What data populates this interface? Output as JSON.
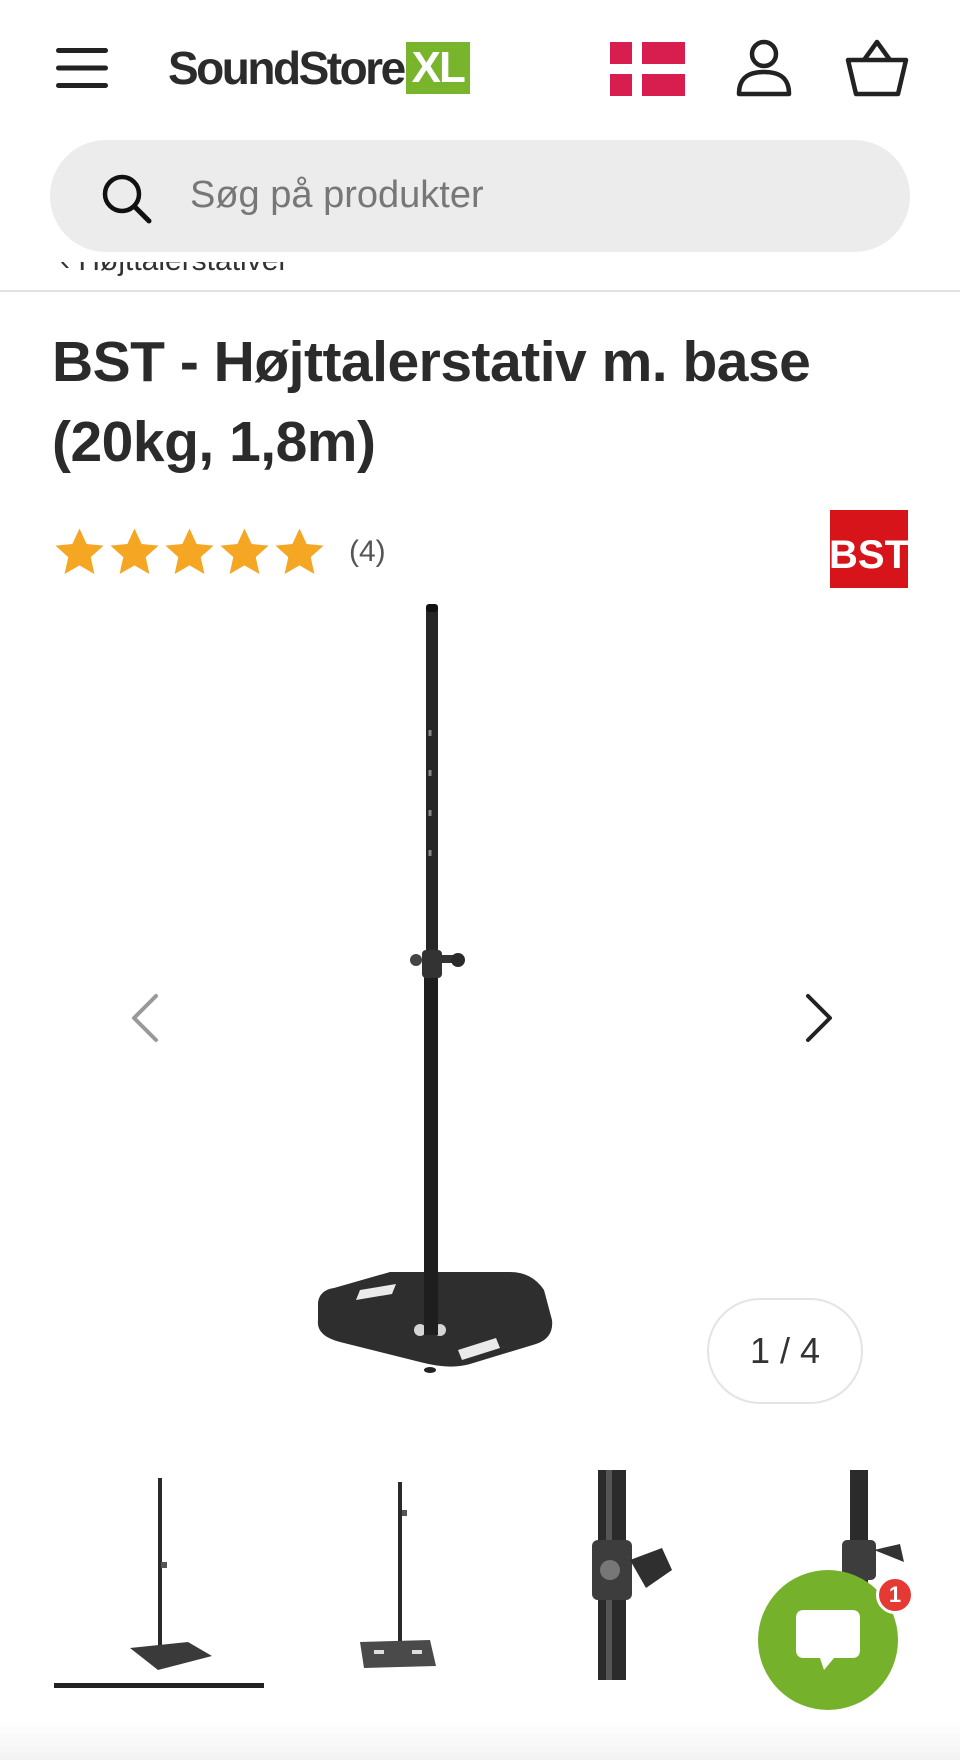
{
  "header": {
    "menu_icon": "hamburger-menu-icon",
    "logo": {
      "text": "SoundStore",
      "badge": "XL",
      "badge_color": "#78b52c"
    },
    "flag_icon": "denmark-flag-icon",
    "account_icon": "user-icon",
    "cart_icon": "basket-icon"
  },
  "search": {
    "placeholder": "Søg på produkter",
    "icon": "search-icon"
  },
  "breadcrumb": {
    "label": "Højttalerstativer"
  },
  "product": {
    "title": "BST - Højttalerstativ m. base (20kg, 1,8m)",
    "rating": {
      "stars": 5,
      "max": 5,
      "count_label": "(4)",
      "star_color": "#f5a623"
    },
    "brand": {
      "text": "BST",
      "color": "#d7141a"
    }
  },
  "gallery": {
    "pager_label": "1 / 4",
    "current": 1,
    "total": 4,
    "prev_icon": "chevron-left-icon",
    "next_icon": "chevron-right-icon"
  },
  "chat": {
    "badge": "1",
    "color": "#76b12b",
    "icon": "chat-bubble-icon"
  }
}
